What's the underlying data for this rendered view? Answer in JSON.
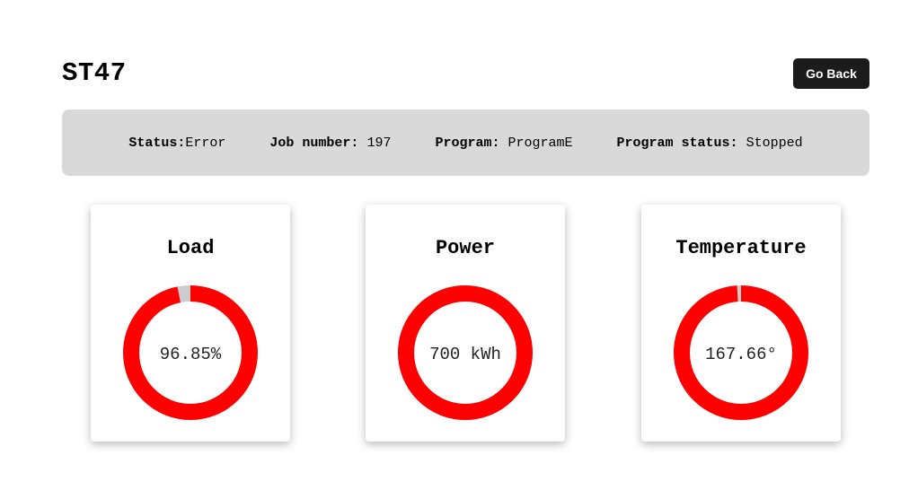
{
  "header": {
    "title": "ST47",
    "go_back_label": "Go Back"
  },
  "status_bar": {
    "status_label": "Status:",
    "status_value": "Error",
    "job_label": "Job number:",
    "job_value": "197",
    "program_label": "Program:",
    "program_value": "ProgramE",
    "program_status_label": "Program status:",
    "program_status_value": "Stopped"
  },
  "gauges": [
    {
      "title": "Load",
      "value_text": "96.85%",
      "fraction": 0.9685
    },
    {
      "title": "Power",
      "value_text": "700 kWh",
      "fraction": 1.0
    },
    {
      "title": "Temperature",
      "value_text": "167.66°",
      "fraction": 0.99
    }
  ],
  "colors": {
    "gauge_fill": "#ff0000",
    "gauge_track": "#cccccc",
    "status_bg": "#d9d9d9",
    "button_bg": "#1b1b1b"
  }
}
